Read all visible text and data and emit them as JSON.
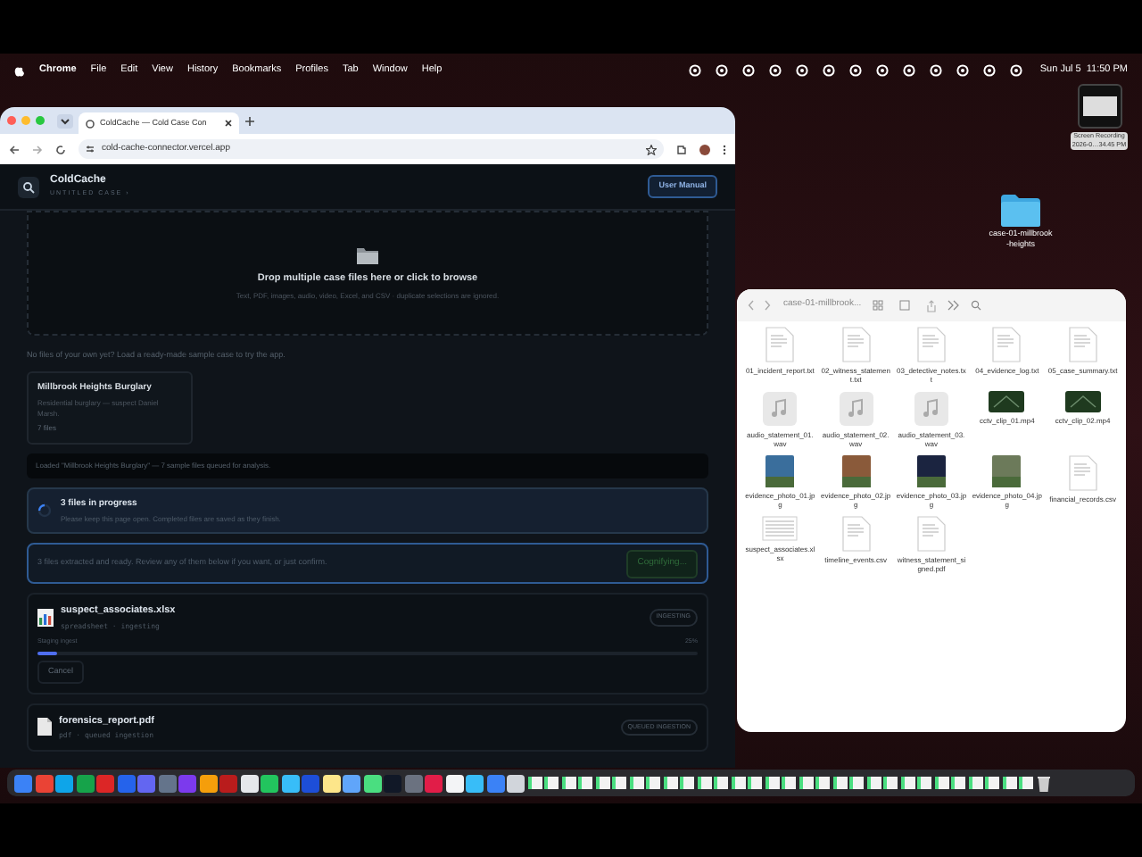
{
  "menu_bar": {
    "app_menus": [
      {
        "label": "Chrome",
        "bold": true
      },
      {
        "label": "File",
        "bold": false
      },
      {
        "label": "Edit",
        "bold": false
      },
      {
        "label": "View",
        "bold": false
      },
      {
        "label": "History",
        "bold": false
      },
      {
        "label": "Bookmarks",
        "bold": false
      },
      {
        "label": "Profiles",
        "bold": false
      },
      {
        "label": "Tab",
        "bold": false
      },
      {
        "label": "Window",
        "bold": false
      },
      {
        "label": "Help",
        "bold": false
      }
    ],
    "clock": "Sun Jul 5  11:50 PM"
  },
  "desktop": {
    "screen_recording": {
      "label": "Screen Recording",
      "sublabel": "2026-0…34.45 PM"
    },
    "folder": {
      "label": "case-01-millbrook-heights"
    }
  },
  "browser": {
    "tab_title": "ColdCache — Cold Case Con",
    "url": "cold-cache-connector.vercel.app"
  },
  "app": {
    "brand": "ColdCache",
    "case_name": "UNTITLED CASE ›",
    "manual_button": "User Manual",
    "dropzone": {
      "title": "Drop multiple case files here or click to browse",
      "hint": "Text, PDF, images, audio, video, Excel, and CSV · duplicate selections are ignored."
    },
    "sample_prompt": "No files of your own yet? Load a ready-made sample case to try the app.",
    "sample_case": {
      "title": "Millbrook Heights Burglary",
      "description": "Residential burglary — suspect Daniel Marsh.",
      "count": "7 files"
    },
    "loaded_notice": "Loaded \"Millbrook Heights Burglary\" — 7 sample files queued for analysis.",
    "progress": {
      "title": "3 files in progress",
      "subtitle": "Please keep this page open. Completed files are saved as they finish."
    },
    "ready": {
      "message": "3 files extracted and ready. Review any of them below if you want, or just confirm.",
      "button": "Cognifying..."
    },
    "files": [
      {
        "name": "suspect_associates.xlsx",
        "kind": "sheet",
        "meta": "spreadsheet · ingesting",
        "status": "INGESTING",
        "stage": "Staging ingest",
        "percent": "25%",
        "level": 0.03,
        "cancel": "Cancel"
      },
      {
        "name": "forensics_report.pdf",
        "kind": "doc",
        "meta": "pdf · queued ingestion",
        "status": "QUEUED INGESTION"
      }
    ]
  },
  "finder": {
    "title": "case-01-millbrook...",
    "files": [
      {
        "name": "01_incident_report.txt",
        "kind": "doc"
      },
      {
        "name": "02_witness_statement.txt",
        "kind": "doc"
      },
      {
        "name": "03_detective_notes.txt",
        "kind": "doc"
      },
      {
        "name": "04_evidence_log.txt",
        "kind": "doc"
      },
      {
        "name": "05_case_summary.txt",
        "kind": "doc"
      },
      {
        "name": "audio_statement_01.wav",
        "kind": "audio"
      },
      {
        "name": "audio_statement_02.wav",
        "kind": "audio"
      },
      {
        "name": "audio_statement_03.wav",
        "kind": "audio"
      },
      {
        "name": "cctv_clip_01.mp4",
        "kind": "video"
      },
      {
        "name": "cctv_clip_02.mp4",
        "kind": "video"
      },
      {
        "name": "evidence_photo_01.jpg",
        "kind": "photo"
      },
      {
        "name": "evidence_photo_02.jpg",
        "kind": "photo"
      },
      {
        "name": "evidence_photo_03.jpg",
        "kind": "photo"
      },
      {
        "name": "evidence_photo_04.jpg",
        "kind": "photo"
      },
      {
        "name": "financial_records.csv",
        "kind": "doc"
      },
      {
        "name": "suspect_associates.xlsx",
        "kind": "sheet"
      },
      {
        "name": "timeline_events.csv",
        "kind": "doc"
      },
      {
        "name": "witness_statement_signed.pdf",
        "kind": "doc"
      }
    ]
  }
}
